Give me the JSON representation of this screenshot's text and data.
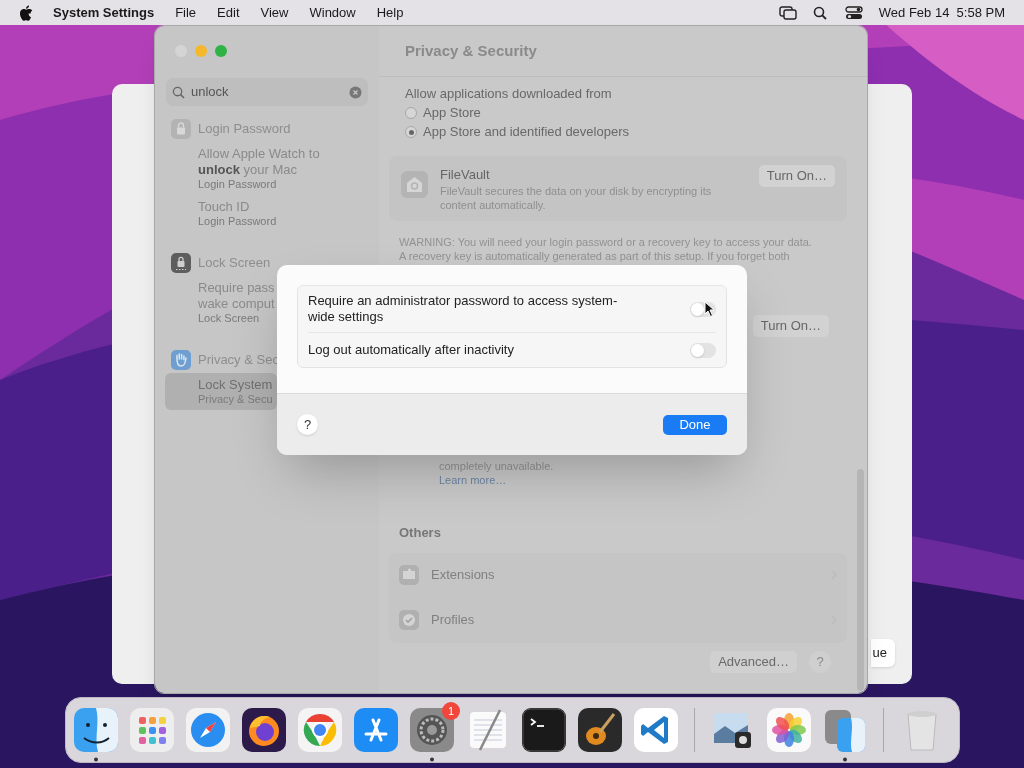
{
  "menu_bar": {
    "app": "System Settings",
    "menus": [
      "File",
      "Edit",
      "View",
      "Window",
      "Help"
    ],
    "clock": "Wed Feb 14  5:58 PM"
  },
  "background_window": {
    "button": "ue"
  },
  "window": {
    "title": "Privacy & Security"
  },
  "sidebar": {
    "search": {
      "value": "unlock"
    },
    "groups": [
      {
        "title": "Login Password",
        "results": [
          {
            "lines": [
              "Allow Apple Watch to",
              "**unlock** your Mac"
            ],
            "subtitle": "Login Password",
            "selected": false
          },
          {
            "lines": [
              "Touch ID"
            ],
            "subtitle": "Login Password",
            "selected": false
          }
        ]
      },
      {
        "title": "Lock Screen",
        "results": [
          {
            "lines": [
              "Require pass",
              "wake comput"
            ],
            "subtitle": "Lock Screen",
            "selected": false
          }
        ]
      },
      {
        "title": "Privacy & Sec",
        "results": [
          {
            "lines": [
              "Lock System"
            ],
            "subtitle": "Privacy & Secu",
            "selected": true
          }
        ]
      }
    ]
  },
  "main": {
    "allow_heading": "Allow applications downloaded from",
    "radios": [
      {
        "label": "App Store",
        "selected": false
      },
      {
        "label": "App Store and identified developers",
        "selected": true
      }
    ],
    "filevault": {
      "title": "FileVault",
      "description": "FileVault secures the data on your disk by encrypting its content automatically.",
      "button": "Turn On…"
    },
    "warning": [
      "WARNING: You will need your login password or a recovery key to access your data.",
      "A recovery key is automatically generated as part of this setup. If you forget both"
    ],
    "second_button": "Turn On…",
    "lockdown_tail": "completely unavailable.",
    "learn_more": "Learn more…",
    "others_heading": "Others",
    "others": [
      {
        "label": "Extensions"
      },
      {
        "label": "Profiles"
      }
    ],
    "advanced_button": "Advanced…",
    "help_button": "?"
  },
  "dialog": {
    "toggles": [
      {
        "label": "Require an administrator password to access system-wide settings",
        "on": false
      },
      {
        "label": "Log out automatically after inactivity",
        "on": false
      }
    ],
    "help_button": "?",
    "done_button": "Done"
  },
  "dock": [
    {
      "kind": "finder",
      "running": true
    },
    {
      "kind": "launchpad",
      "running": false
    },
    {
      "kind": "safari",
      "running": false
    },
    {
      "kind": "firefox",
      "running": false
    },
    {
      "kind": "chrome",
      "running": false
    },
    {
      "kind": "appstore",
      "running": false
    },
    {
      "kind": "settings",
      "running": true,
      "badge": "1"
    },
    {
      "kind": "textedit",
      "running": false
    },
    {
      "kind": "terminal",
      "running": false
    },
    {
      "kind": "garageband",
      "running": false
    },
    {
      "kind": "vscode",
      "running": false
    },
    {
      "kind": "separator"
    },
    {
      "kind": "preview",
      "running": false
    },
    {
      "kind": "photos",
      "running": false
    },
    {
      "kind": "migration",
      "running": true
    },
    {
      "kind": "separator"
    },
    {
      "kind": "trash",
      "running": false
    }
  ]
}
